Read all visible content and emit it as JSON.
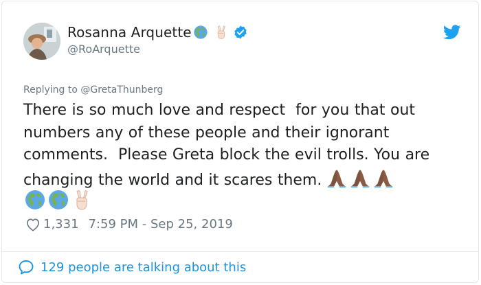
{
  "colors": {
    "text": "#1c2022",
    "muted": "#697882",
    "twitter_blue": "#1da1f2",
    "link_blue": "#1b95e0",
    "border": "#e1e8ed"
  },
  "author": {
    "display_name": "Rosanna Arquette",
    "name_emojis": [
      "earth-globe-americas",
      "victory-hand"
    ],
    "verified": true,
    "handle": "@RoArquette",
    "avatar": "avatar-photo"
  },
  "tweet": {
    "reply_label": "Replying to @GretaThunberg",
    "text": "There is so much love and respect  for you that out numbers any of these people and their ignorant comments.  Please Greta block the evil trolls. You are changing the world and it scares them.",
    "trailing_emojis": [
      "folded-hands",
      "folded-hands",
      "folded-hands",
      "earth-globe-americas",
      "earth-globe-americas",
      "victory-hand"
    ]
  },
  "meta": {
    "like_count": "1,331",
    "timestamp": "7:59 PM - Sep 25, 2019"
  },
  "footer": {
    "talking_text": "129 people are talking about this"
  }
}
